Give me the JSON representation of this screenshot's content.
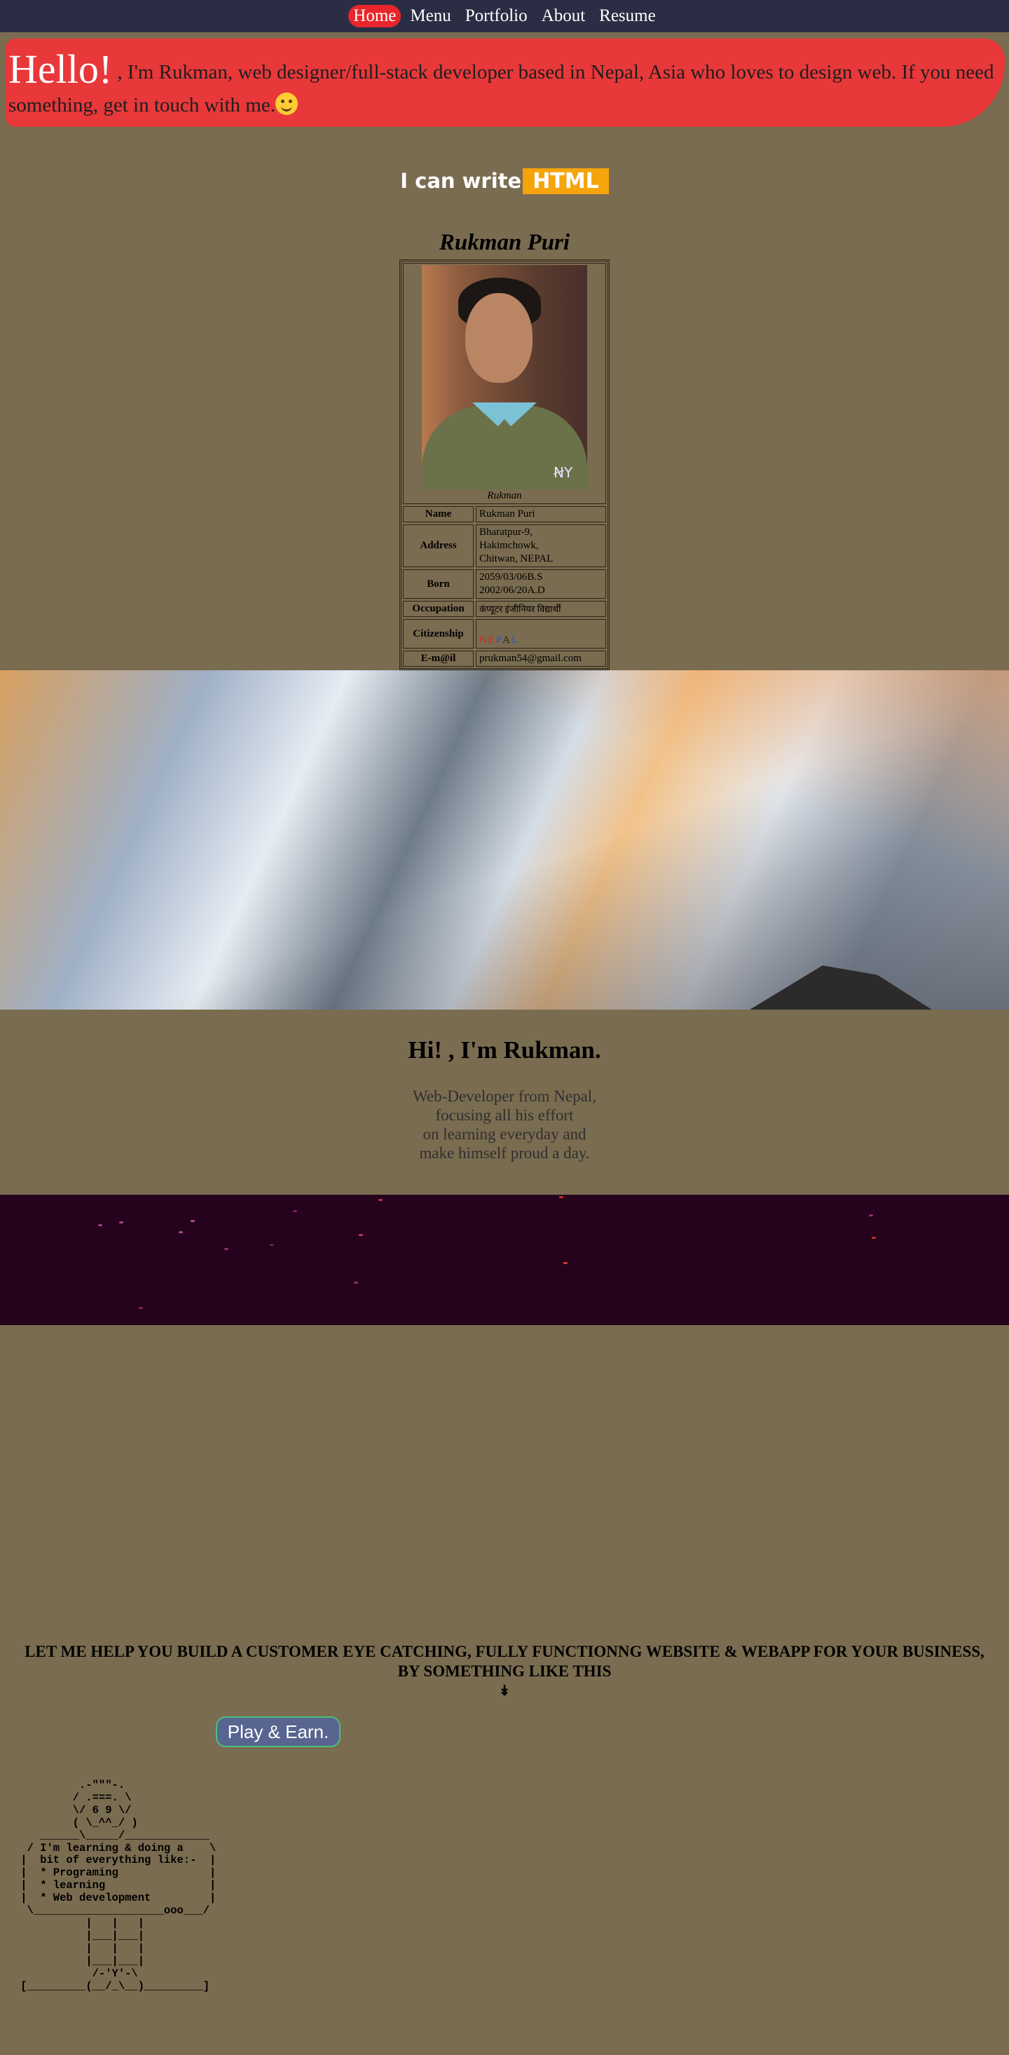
{
  "nav": {
    "items": [
      {
        "label": "Home",
        "active": true
      },
      {
        "label": "Menu",
        "active": false
      },
      {
        "label": "Portfolio",
        "active": false
      },
      {
        "label": "About",
        "active": false
      },
      {
        "label": "Resume",
        "active": false
      }
    ]
  },
  "hello": {
    "greeting": "Hello!",
    "text": " , I'm Rukman, web designer/full-stack developer based in Nepal, Asia who loves to design web. If you need something, get in touch with me."
  },
  "typing": {
    "prefix": "I can write",
    "word": "HTML"
  },
  "profile": {
    "title": "Rukman Puri",
    "caption": "Rukman",
    "rows": [
      {
        "key": "Name",
        "value": "Rukman Puri"
      },
      {
        "key": "Address",
        "value": "Bharatpur-9,\nHakimchowk,\nChitwan, NEPAL"
      },
      {
        "key": "Born",
        "value": "2059/03/06B.S\n2002/06/20A.D"
      },
      {
        "key": "Occupation",
        "value": "कंप्यूटर इंजीनियर विद्यार्थी"
      },
      {
        "key": "Citizenship",
        "value": ""
      },
      {
        "key": "E-m@il",
        "value": "prukman54@gmail.com"
      }
    ],
    "citizenship_letters": [
      "N",
      "E",
      "P",
      "A",
      "L"
    ]
  },
  "about": {
    "title": "Hi! , I'm Rukman.",
    "lines": [
      "Web-Developer from Nepal,",
      "focusing all his effort",
      "on learning everyday and",
      "make himself proud a day."
    ]
  },
  "cta": {
    "line1": "LET ME HELP YOU BUILD A CUSTOMER EYE CATCHING, FULLY FUNCTIONNG WEBSITE & WEBAPP FOR YOUR BUSINESS,",
    "line2": "BY SOMETHING LIKE THIS",
    "arrow": "↡",
    "button": "Play & Earn."
  },
  "ascii_art": "          .-\"\"\"-.\n         / .===. \\\n         \\/ 6 9 \\/\n         ( \\_^^_/ )\n    ______\\_____/_____________\n  / I'm learning & doing a    \\\n |  bit of everything like:-  |\n |  * Programing              |\n |  * learning                |\n |  * Web development         |\n  \\____________________ooo___/\n           |   |   |\n           |___|___|\n           |   |   |\n           |___|___|\n            /-'Y'-\\\n [_________(__/_\\__)_________]",
  "colors": {
    "background": "#7a6c50",
    "nav": "#2b2d45",
    "accent_red": "#e8383a",
    "highlight": "#f5a40c",
    "band": "#25031c",
    "button": "#586590"
  },
  "icons": {
    "emoji": "smiling-face-icon",
    "nav_active": "pill-highlight"
  }
}
